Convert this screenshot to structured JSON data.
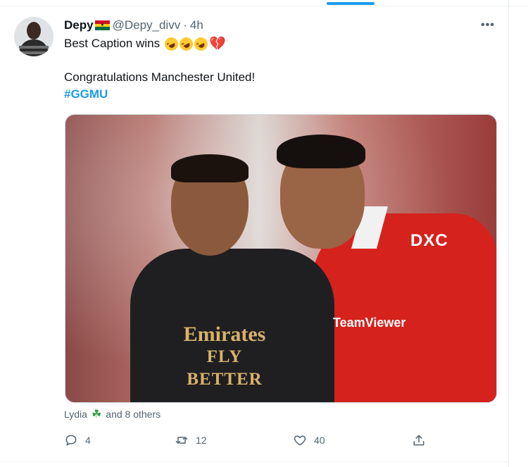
{
  "tweet": {
    "display_name": "Depy",
    "handle": "@Depy_divv",
    "separator": "·",
    "time": "4h",
    "more_label": "•••",
    "text_line1": "Best Caption wins",
    "text_line2": "Congratulations Manchester United!",
    "hashtag": "#GGMU",
    "emojis": [
      "rolling-on-floor-laughing",
      "rolling-on-floor-laughing",
      "rolling-on-floor-laughing",
      "broken-heart"
    ],
    "flag": "ghana-flag"
  },
  "photo": {
    "sponsor_line1": "Emirates",
    "sponsor_line2": "FLY BETTER",
    "sponsor_right": "DXC",
    "sponsor_teamviewer": "TeamViewer"
  },
  "likers": {
    "name": "Lydia",
    "clover": "☘",
    "others": "and 8 others"
  },
  "actions": {
    "replies": "4",
    "retweets": "12",
    "likes": "40"
  },
  "colors": {
    "accent": "#1d9bf0",
    "text": "#0f1419",
    "muted": "#536471"
  }
}
